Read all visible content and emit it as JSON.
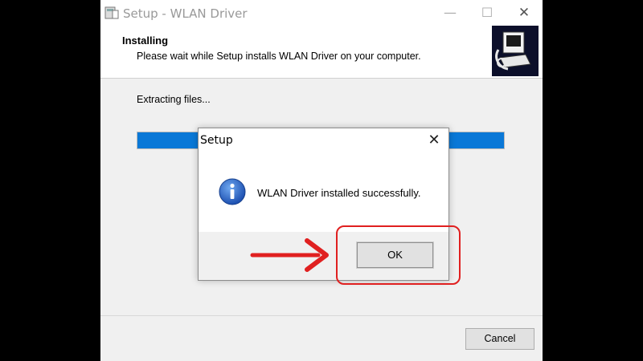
{
  "main_window": {
    "title": "Setup - WLAN Driver",
    "controls": {
      "minimize": "—",
      "maximize": "☐",
      "close": "✕"
    },
    "header": {
      "title": "Installing",
      "subtitle": "Please wait while Setup installs WLAN Driver on your computer."
    },
    "status": "Extracting files...",
    "progress": 1.0,
    "cancel_label": "Cancel"
  },
  "dialog": {
    "title": "Setup",
    "close": "✕",
    "icon": "info-icon",
    "message": "WLAN Driver installed successfully.",
    "ok_label": "OK"
  },
  "annotations": {
    "highlight_color": "#e02020",
    "arrow_color": "#e02020"
  },
  "colors": {
    "progress": "#0a78d7",
    "info_icon": "#1c64c8"
  }
}
